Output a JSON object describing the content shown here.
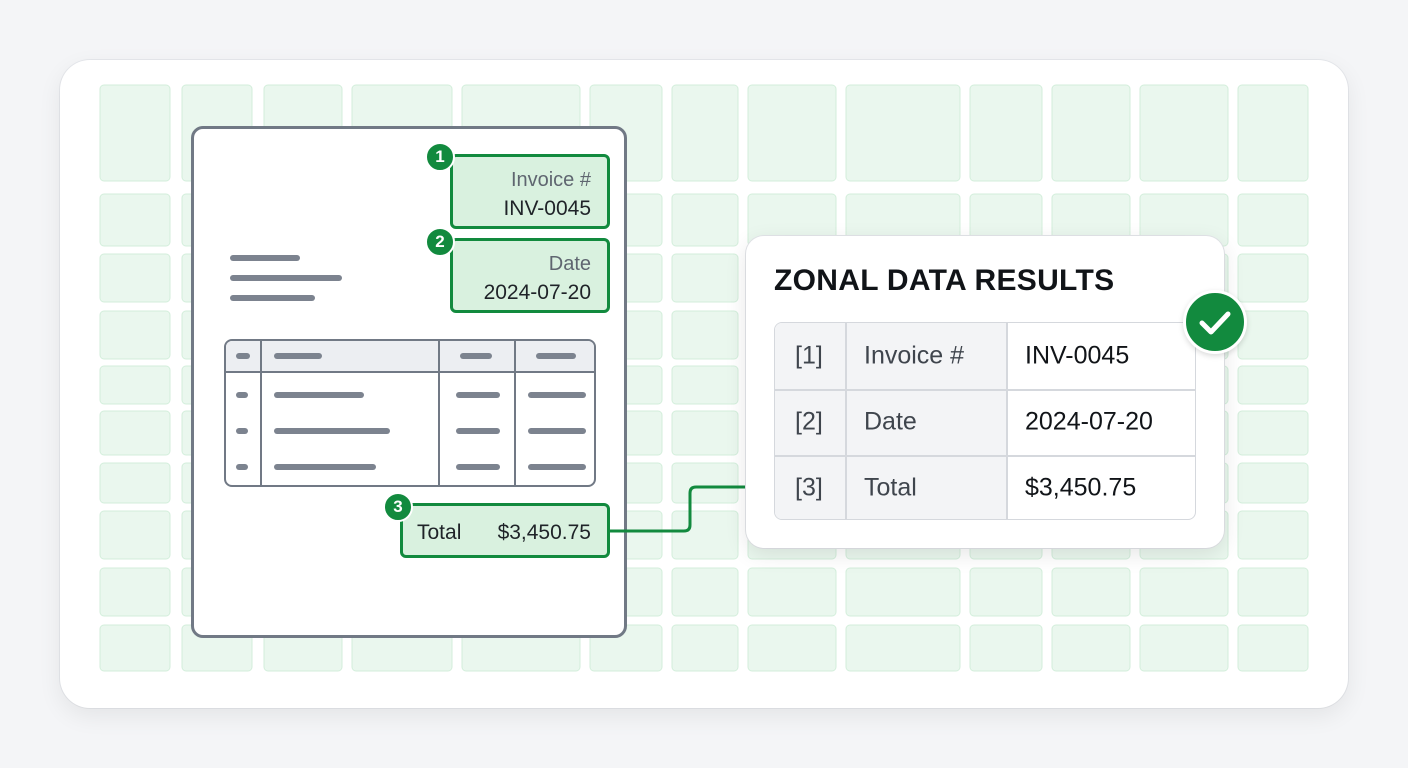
{
  "colors": {
    "accent": "#128a3e",
    "zone_fill": "#d9f1df",
    "grid_cell": "#eaf7ee",
    "doc_stroke": "#717985"
  },
  "document": {
    "zones": [
      {
        "badge": "1",
        "label": "Invoice #",
        "value": "INV-0045"
      },
      {
        "badge": "2",
        "label": "Date",
        "value": "2024-07-20"
      },
      {
        "badge": "3",
        "label": "Total",
        "value": "$3,450.75"
      }
    ]
  },
  "results": {
    "title": "ZONAL DATA RESULTS",
    "rows": [
      {
        "index": "[1]",
        "field": "Invoice #",
        "value": "INV-0045"
      },
      {
        "index": "[2]",
        "field": "Date",
        "value": "2024-07-20"
      },
      {
        "index": "[3]",
        "field": "Total",
        "value": "$3,450.75"
      }
    ],
    "status_icon": "check-circle-icon"
  }
}
